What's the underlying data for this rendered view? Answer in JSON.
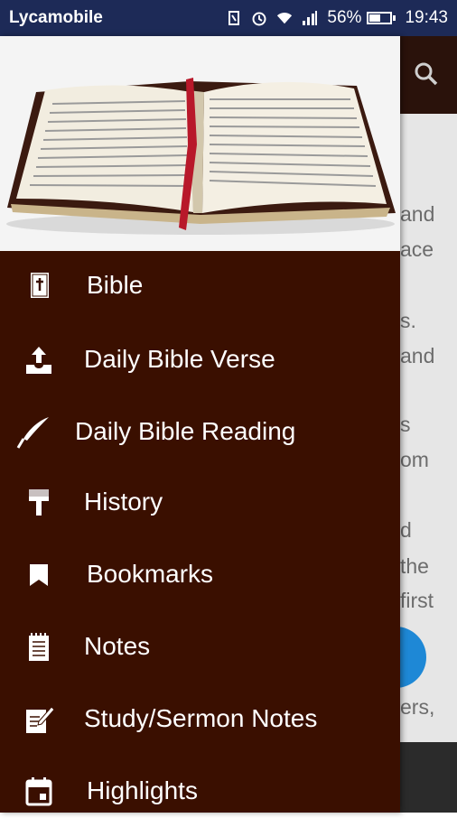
{
  "status_bar": {
    "carrier": "Lycamobile",
    "battery_percent": "56%",
    "battery_level": 0.56,
    "time": "19:43",
    "icons": [
      "nfc-icon",
      "alarm-icon",
      "wifi-icon",
      "signal-icon",
      "battery-icon"
    ]
  },
  "background": {
    "text_fragments": [
      "and",
      "ace",
      "s.",
      "and",
      "s",
      "om",
      "d",
      "the",
      "first",
      "ers,"
    ]
  },
  "drawer": {
    "header_image": "open-bible-photo",
    "items": [
      {
        "label": "Bible",
        "icon": "bible-book-icon"
      },
      {
        "label": "Daily Bible Verse",
        "icon": "inbox-upload-icon"
      },
      {
        "label": "Daily Bible Reading",
        "icon": "quill-pen-icon"
      },
      {
        "label": "History",
        "icon": "brush-icon"
      },
      {
        "label": "Bookmarks",
        "icon": "bookmark-icon"
      },
      {
        "label": "Notes",
        "icon": "notepad-icon"
      },
      {
        "label": "Study/Sermon Notes",
        "icon": "edit-note-icon"
      },
      {
        "label": "Highlights",
        "icon": "calendar-icon"
      }
    ]
  },
  "colors": {
    "drawer_bg": "#3a0f00",
    "status_bar_bg": "#1d2a57",
    "fab": "#1e88d6"
  }
}
